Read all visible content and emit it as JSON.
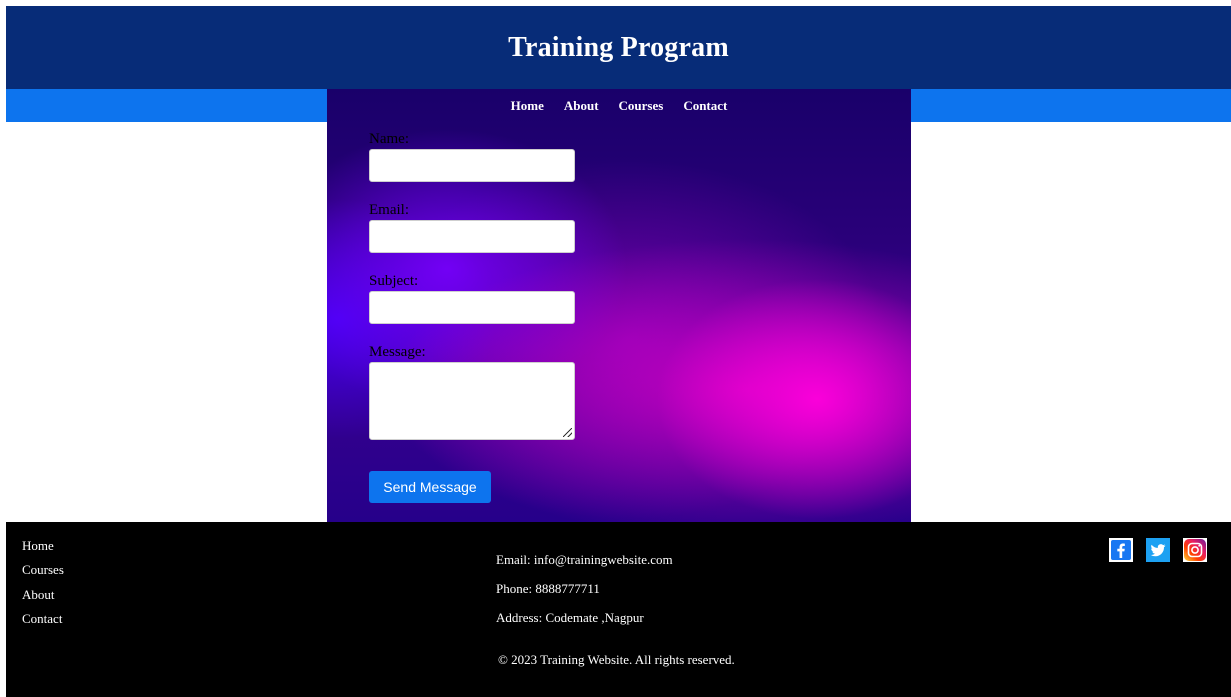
{
  "header": {
    "title": "Training Program"
  },
  "nav": {
    "items": [
      "Home",
      "About",
      "Courses",
      "Contact"
    ]
  },
  "form": {
    "name_label": "Name:",
    "email_label": "Email:",
    "subject_label": "Subject:",
    "message_label": "Message:",
    "name_value": "",
    "email_value": "",
    "subject_value": "",
    "message_value": "",
    "submit_label": "Send Message"
  },
  "footer": {
    "links": [
      "Home",
      "Courses",
      "About",
      "Contact"
    ],
    "email": "Email: info@trainingwebsite.com",
    "phone": "Phone: 8888777711",
    "address": "Address: Codemate ,Nagpur",
    "copyright": "© 2023 Training Website. All rights reserved.",
    "social_icons": [
      "facebook-icon",
      "twitter-icon",
      "instagram-icon"
    ]
  },
  "colors": {
    "header_bg": "#072c78",
    "navbar_bg": "#0d74ee",
    "button_bg": "#0d74ee",
    "footer_bg": "#000000"
  }
}
